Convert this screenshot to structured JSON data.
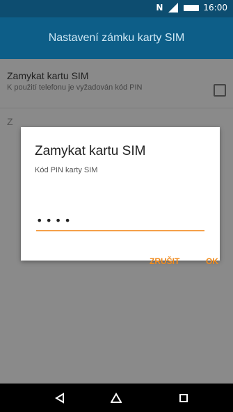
{
  "status_bar": {
    "time": "16:00",
    "icons": [
      "nfc-icon",
      "signal-icon",
      "battery-icon"
    ]
  },
  "app_bar": {
    "title": "Nastavení zámku karty SIM"
  },
  "settings": {
    "lock_sim": {
      "title": "Zamykat kartu SIM",
      "subtitle": "K použití telefonu je vyžadován kód PIN",
      "checked": false
    },
    "second_row_partial": "Z"
  },
  "dialog": {
    "title": "Zamykat kartu SIM",
    "message": "Kód PIN karty SIM",
    "pin_value": "••••",
    "cancel_label": "ZRUŠIT",
    "ok_label": "OK",
    "accent_color": "#f08a1c"
  },
  "nav_bar": {
    "icons": [
      "back-icon",
      "home-icon",
      "recent-apps-icon"
    ]
  }
}
